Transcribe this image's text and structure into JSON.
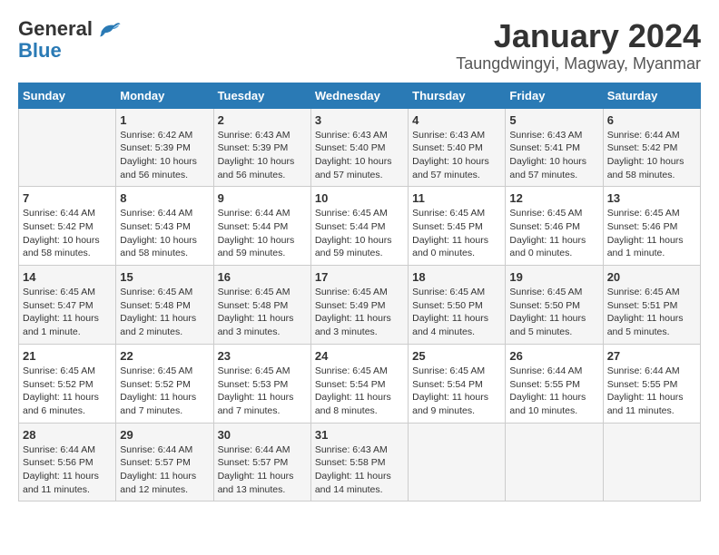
{
  "logo": {
    "general": "General",
    "blue": "Blue"
  },
  "title": {
    "month": "January 2024",
    "location": "Taungdwingyi, Magway, Myanmar"
  },
  "headers": [
    "Sunday",
    "Monday",
    "Tuesday",
    "Wednesday",
    "Thursday",
    "Friday",
    "Saturday"
  ],
  "weeks": [
    [
      {
        "day": "",
        "sunrise": "",
        "sunset": "",
        "daylight": ""
      },
      {
        "day": "1",
        "sunrise": "Sunrise: 6:42 AM",
        "sunset": "Sunset: 5:39 PM",
        "daylight": "Daylight: 10 hours and 56 minutes."
      },
      {
        "day": "2",
        "sunrise": "Sunrise: 6:43 AM",
        "sunset": "Sunset: 5:39 PM",
        "daylight": "Daylight: 10 hours and 56 minutes."
      },
      {
        "day": "3",
        "sunrise": "Sunrise: 6:43 AM",
        "sunset": "Sunset: 5:40 PM",
        "daylight": "Daylight: 10 hours and 57 minutes."
      },
      {
        "day": "4",
        "sunrise": "Sunrise: 6:43 AM",
        "sunset": "Sunset: 5:40 PM",
        "daylight": "Daylight: 10 hours and 57 minutes."
      },
      {
        "day": "5",
        "sunrise": "Sunrise: 6:43 AM",
        "sunset": "Sunset: 5:41 PM",
        "daylight": "Daylight: 10 hours and 57 minutes."
      },
      {
        "day": "6",
        "sunrise": "Sunrise: 6:44 AM",
        "sunset": "Sunset: 5:42 PM",
        "daylight": "Daylight: 10 hours and 58 minutes."
      }
    ],
    [
      {
        "day": "7",
        "sunrise": "Sunrise: 6:44 AM",
        "sunset": "Sunset: 5:42 PM",
        "daylight": "Daylight: 10 hours and 58 minutes."
      },
      {
        "day": "8",
        "sunrise": "Sunrise: 6:44 AM",
        "sunset": "Sunset: 5:43 PM",
        "daylight": "Daylight: 10 hours and 58 minutes."
      },
      {
        "day": "9",
        "sunrise": "Sunrise: 6:44 AM",
        "sunset": "Sunset: 5:44 PM",
        "daylight": "Daylight: 10 hours and 59 minutes."
      },
      {
        "day": "10",
        "sunrise": "Sunrise: 6:45 AM",
        "sunset": "Sunset: 5:44 PM",
        "daylight": "Daylight: 10 hours and 59 minutes."
      },
      {
        "day": "11",
        "sunrise": "Sunrise: 6:45 AM",
        "sunset": "Sunset: 5:45 PM",
        "daylight": "Daylight: 11 hours and 0 minutes."
      },
      {
        "day": "12",
        "sunrise": "Sunrise: 6:45 AM",
        "sunset": "Sunset: 5:46 PM",
        "daylight": "Daylight: 11 hours and 0 minutes."
      },
      {
        "day": "13",
        "sunrise": "Sunrise: 6:45 AM",
        "sunset": "Sunset: 5:46 PM",
        "daylight": "Daylight: 11 hours and 1 minute."
      }
    ],
    [
      {
        "day": "14",
        "sunrise": "Sunrise: 6:45 AM",
        "sunset": "Sunset: 5:47 PM",
        "daylight": "Daylight: 11 hours and 1 minute."
      },
      {
        "day": "15",
        "sunrise": "Sunrise: 6:45 AM",
        "sunset": "Sunset: 5:48 PM",
        "daylight": "Daylight: 11 hours and 2 minutes."
      },
      {
        "day": "16",
        "sunrise": "Sunrise: 6:45 AM",
        "sunset": "Sunset: 5:48 PM",
        "daylight": "Daylight: 11 hours and 3 minutes."
      },
      {
        "day": "17",
        "sunrise": "Sunrise: 6:45 AM",
        "sunset": "Sunset: 5:49 PM",
        "daylight": "Daylight: 11 hours and 3 minutes."
      },
      {
        "day": "18",
        "sunrise": "Sunrise: 6:45 AM",
        "sunset": "Sunset: 5:50 PM",
        "daylight": "Daylight: 11 hours and 4 minutes."
      },
      {
        "day": "19",
        "sunrise": "Sunrise: 6:45 AM",
        "sunset": "Sunset: 5:50 PM",
        "daylight": "Daylight: 11 hours and 5 minutes."
      },
      {
        "day": "20",
        "sunrise": "Sunrise: 6:45 AM",
        "sunset": "Sunset: 5:51 PM",
        "daylight": "Daylight: 11 hours and 5 minutes."
      }
    ],
    [
      {
        "day": "21",
        "sunrise": "Sunrise: 6:45 AM",
        "sunset": "Sunset: 5:52 PM",
        "daylight": "Daylight: 11 hours and 6 minutes."
      },
      {
        "day": "22",
        "sunrise": "Sunrise: 6:45 AM",
        "sunset": "Sunset: 5:52 PM",
        "daylight": "Daylight: 11 hours and 7 minutes."
      },
      {
        "day": "23",
        "sunrise": "Sunrise: 6:45 AM",
        "sunset": "Sunset: 5:53 PM",
        "daylight": "Daylight: 11 hours and 7 minutes."
      },
      {
        "day": "24",
        "sunrise": "Sunrise: 6:45 AM",
        "sunset": "Sunset: 5:54 PM",
        "daylight": "Daylight: 11 hours and 8 minutes."
      },
      {
        "day": "25",
        "sunrise": "Sunrise: 6:45 AM",
        "sunset": "Sunset: 5:54 PM",
        "daylight": "Daylight: 11 hours and 9 minutes."
      },
      {
        "day": "26",
        "sunrise": "Sunrise: 6:44 AM",
        "sunset": "Sunset: 5:55 PM",
        "daylight": "Daylight: 11 hours and 10 minutes."
      },
      {
        "day": "27",
        "sunrise": "Sunrise: 6:44 AM",
        "sunset": "Sunset: 5:55 PM",
        "daylight": "Daylight: 11 hours and 11 minutes."
      }
    ],
    [
      {
        "day": "28",
        "sunrise": "Sunrise: 6:44 AM",
        "sunset": "Sunset: 5:56 PM",
        "daylight": "Daylight: 11 hours and 11 minutes."
      },
      {
        "day": "29",
        "sunrise": "Sunrise: 6:44 AM",
        "sunset": "Sunset: 5:57 PM",
        "daylight": "Daylight: 11 hours and 12 minutes."
      },
      {
        "day": "30",
        "sunrise": "Sunrise: 6:44 AM",
        "sunset": "Sunset: 5:57 PM",
        "daylight": "Daylight: 11 hours and 13 minutes."
      },
      {
        "day": "31",
        "sunrise": "Sunrise: 6:43 AM",
        "sunset": "Sunset: 5:58 PM",
        "daylight": "Daylight: 11 hours and 14 minutes."
      },
      {
        "day": "",
        "sunrise": "",
        "sunset": "",
        "daylight": ""
      },
      {
        "day": "",
        "sunrise": "",
        "sunset": "",
        "daylight": ""
      },
      {
        "day": "",
        "sunrise": "",
        "sunset": "",
        "daylight": ""
      }
    ]
  ]
}
